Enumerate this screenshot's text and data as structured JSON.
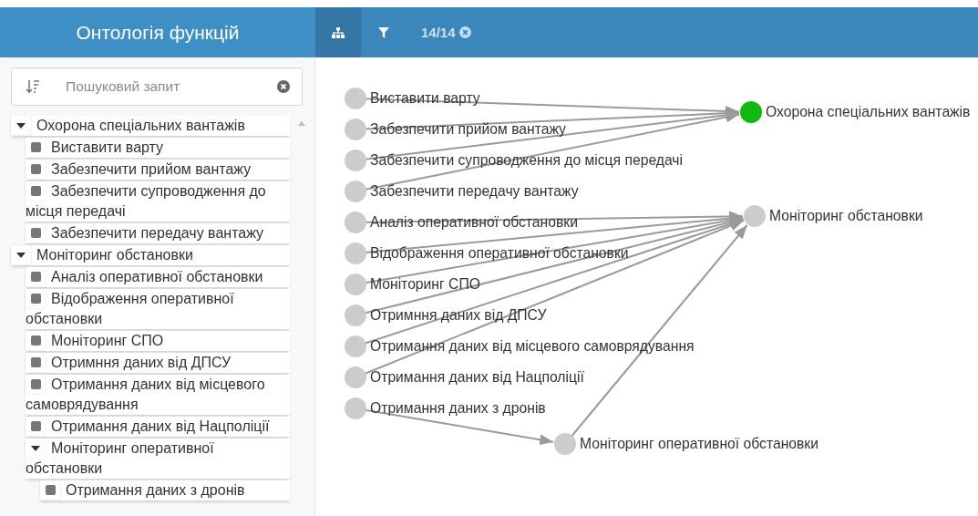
{
  "header": {
    "title": "Онтологія функцій"
  },
  "toolbar": {
    "tabs": [
      {
        "kind": "hierarchy",
        "selected": true
      },
      {
        "kind": "filter",
        "selected": false
      }
    ],
    "filter_count": "14/14"
  },
  "search": {
    "placeholder": "Пошуковий запит"
  },
  "tree": [
    {
      "label": "Охорона спеціальних вантажів",
      "expanded": true,
      "children": [
        {
          "label": "Виставити варту"
        },
        {
          "label": "Забезпечити прийом вантажу"
        },
        {
          "label": "Забезпечити супроводження до місця передачі"
        },
        {
          "label": "Забезпечити передачу вантажу"
        }
      ]
    },
    {
      "label": "Моніторинг обстановки",
      "expanded": true,
      "children": [
        {
          "label": "Аналіз оперативної обстановки"
        },
        {
          "label": "Відображення оперативної обстановки"
        },
        {
          "label": "Моніторинг СПО"
        },
        {
          "label": "Отримння даних від ДПСУ"
        },
        {
          "label": "Отримання даних від місцевого самоврядування"
        },
        {
          "label": "Отримання даних від Нацполіції"
        },
        {
          "label": "Моніторинг оперативної обстановки",
          "expanded": true,
          "children": [
            {
              "label": "Отримання даних з дронів"
            }
          ]
        }
      ]
    }
  ],
  "graph": {
    "roots": [
      {
        "label": "Охорона спеціальних вантажів",
        "selected": true,
        "inputs": [
          {
            "label": "Виставити варту",
            "selected": false
          },
          {
            "label": "Забезпечити прийом вантажу",
            "selected": false
          },
          {
            "label": "Забезпечити супроводження до місця передачі",
            "selected": false
          },
          {
            "label": "Забезпечити передачу вантажу",
            "selected": false
          }
        ]
      },
      {
        "label": "Моніторинг обстановки",
        "selected": false,
        "inputs": [
          {
            "label": "Аналіз оперативної обстановки",
            "selected": false
          },
          {
            "label": "Відображення оперативної обстановки",
            "selected": false
          },
          {
            "label": "Моніторинг СПО",
            "selected": false
          },
          {
            "label": "Отримння даних від ДПСУ",
            "selected": false
          },
          {
            "label": "Отримання даних від місцевого самоврядування",
            "selected": false
          },
          {
            "label": "Отримання даних від Нацполіції",
            "selected": false
          },
          {
            "label": "Моніторинг оперативної обстановки",
            "selected": false,
            "inputs": [
              {
                "label": "Отримання даних з дронів",
                "selected": false
              }
            ]
          }
        ]
      }
    ]
  }
}
